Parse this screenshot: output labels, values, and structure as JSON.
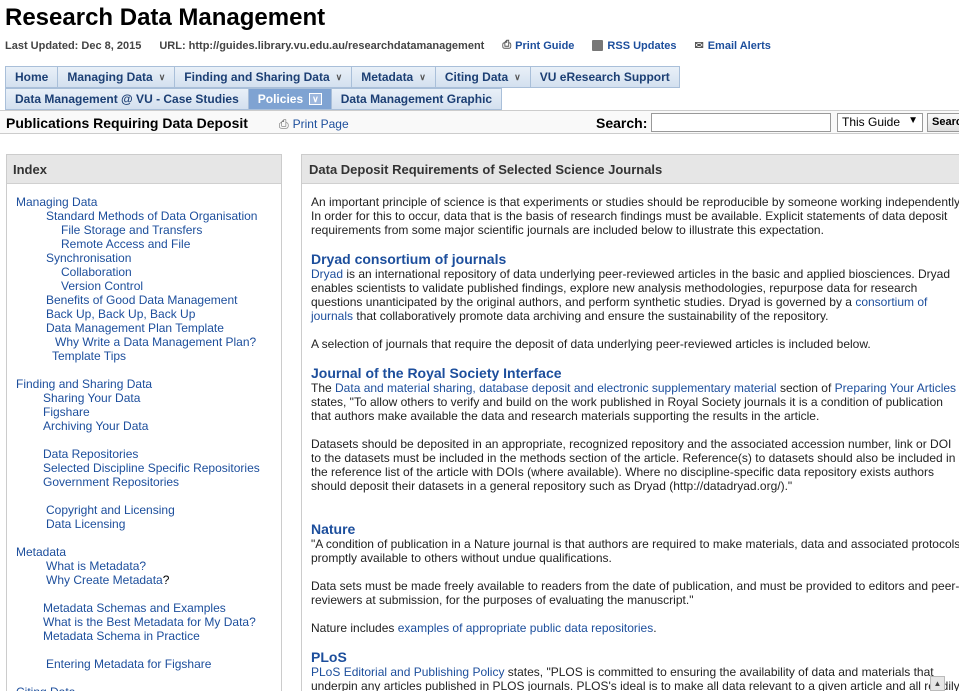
{
  "header": {
    "title": "Research Data Management",
    "last_updated": "Last Updated: Dec 8, 2015",
    "url": "URL: http://guides.library.vu.edu.au/researchdatamanagement",
    "print_guide": "Print Guide",
    "rss_updates": "RSS Updates",
    "email_alerts": "Email Alerts"
  },
  "tabs_row1": [
    {
      "label": "Home",
      "dropdown": false
    },
    {
      "label": "Managing Data",
      "dropdown": true
    },
    {
      "label": "Finding and Sharing Data",
      "dropdown": true
    },
    {
      "label": "Metadata",
      "dropdown": true
    },
    {
      "label": "Citing Data",
      "dropdown": true
    },
    {
      "label": "VU eResearch Support",
      "dropdown": false
    }
  ],
  "tabs_row2": [
    {
      "label": "Data Management @ VU - Case Studies",
      "dropdown": false
    },
    {
      "label": "Policies",
      "dropdown": true,
      "active": true
    },
    {
      "label": "Data Management Graphic",
      "dropdown": false
    }
  ],
  "subbar": {
    "page_title": "Publications Requiring Data Deposit",
    "print_page": "Print Page",
    "search_label": "Search:",
    "search_value": "",
    "scope": "This Guide",
    "search_button": "Search"
  },
  "index": {
    "title": "Index",
    "items": [
      {
        "text": "Managing Data",
        "level": 0
      },
      {
        "text": "Standard Methods of Data Organisation",
        "level": 2
      },
      {
        "text": "File Storage and Transfers",
        "level": 3
      },
      {
        "text": "Remote Access and File",
        "level": 3
      },
      {
        "text": "Synchronisation",
        "level": 2
      },
      {
        "text": "Collaboration",
        "level": 3
      },
      {
        "text": "Version Control",
        "level": 3
      },
      {
        "text": "Benefits of Good Data Management",
        "level": 2
      },
      {
        "text": "Back Up, Back Up, Back Up",
        "level": 2
      },
      {
        "text": "Data Management Plan Template",
        "level": 2
      },
      {
        "text": "Why Write a Data Management Plan?",
        "level": 2.6
      },
      {
        "text": "Template Tips",
        "level": 2.4
      },
      {
        "text": "Finding and Sharing Data",
        "level": 0,
        "gap": true
      },
      {
        "text": "Sharing Your Data",
        "level": 1.8
      },
      {
        "text": "Figshare",
        "level": 1.8
      },
      {
        "text": "Archiving Your Data",
        "level": 1.8
      },
      {
        "text": "Data Repositories",
        "level": 1.8,
        "gap": true
      },
      {
        "text": "Selected Discipline Specific Repositories",
        "level": 1.8
      },
      {
        "text": "Government Repositories",
        "level": 1.8
      },
      {
        "text": "Copyright and Licensing",
        "level": 2,
        "gap": true
      },
      {
        "text": "Data Licensing",
        "level": 2
      },
      {
        "text": "Metadata",
        "level": 0,
        "gap": true
      },
      {
        "text": "What is Metadata?",
        "level": 2
      },
      {
        "text": "Why Create Metadata",
        "level": 2,
        "suffix": "?"
      },
      {
        "text": "Metadata Schemas and Examples",
        "level": 1.8,
        "gap": true
      },
      {
        "text": "What is the Best Metadata for My Data?",
        "level": 1.8
      },
      {
        "text": "Metadata Schema in Practice",
        "level": 1.8
      },
      {
        "text": "Entering Metadata for Figshare",
        "level": 2,
        "gap": true
      },
      {
        "text": "Citing Data",
        "level": 0,
        "gap": true
      }
    ]
  },
  "content": {
    "title": "Data Deposit Requirements of Selected Science Journals",
    "intro": "An important principle of science is that experiments or studies should be reproducible by someone working independently.  In order for this to occur, data that is the basis of research findings must be available.  Explicit statements of data deposit requirements from some major scientific journals are included below to illustrate this expectation.",
    "dryad": {
      "heading": "Dryad consortium of journals",
      "link1": "Dryad",
      "text1": " is an international repository of data underlying peer-reviewed articles in the basic and applied biosciences. Dryad enables scientists to validate published findings, explore new analysis methodologies, repurpose data for research questions unanticipated by the original authors, and perform synthetic studies. Dryad is governed by a ",
      "link2": "consortium of journals",
      "text2": " that collaboratively promote data archiving and ensure the sustainability of the repository.",
      "para2": "A selection of journals that require the deposit of data underlying peer-reviewed articles is included below."
    },
    "royal": {
      "heading": "Journal of the Royal Society Interface",
      "pre": "The ",
      "link1": "Data and material sharing, database deposit and electronic supplementary material",
      "mid": " section of ",
      "link2": "Preparing Your Articles",
      "text": " states, \"To allow others to verify and build on the work published in Royal Society journals it is a condition of publication that authors make available the data and research materials supporting the results in the article.",
      "para2": "Datasets should be deposited in an appropriate, recognized repository and the associated accession number, link or DOI to the datasets must be included in the methods section of the article. Reference(s) to datasets should also be included in the reference list of the article with DOIs (where available). Where no discipline-specific data repository exists authors should deposit their datasets in a general repository such as Dryad (http://datadryad.org/).\""
    },
    "nature": {
      "heading": "Nature",
      "para1": "\"A condition of publication in a Nature journal is that authors are required to make materials, data and associated protocols promptly available to others without undue qualifications.",
      "para2": "Data sets must be made freely available to readers from the date of publication, and must be provided to editors and peer-reviewers at submission, for the purposes of evaluating the manuscript.\"",
      "pre3": "Nature includes ",
      "link3": "examples of appropriate public data repositories",
      "post3": "."
    },
    "plos": {
      "heading": "PLoS",
      "link1": "PLoS Editorial and Publishing Policy",
      "text": " states, \"PLOS is committed to ensuring the availability of data and materials that underpin any articles published in PLOS journals. PLOS's ideal is to make all data relevant to a given article and all readily replaceable materials immediately available without restrictions (while not compromising confidentiality in the"
    }
  }
}
